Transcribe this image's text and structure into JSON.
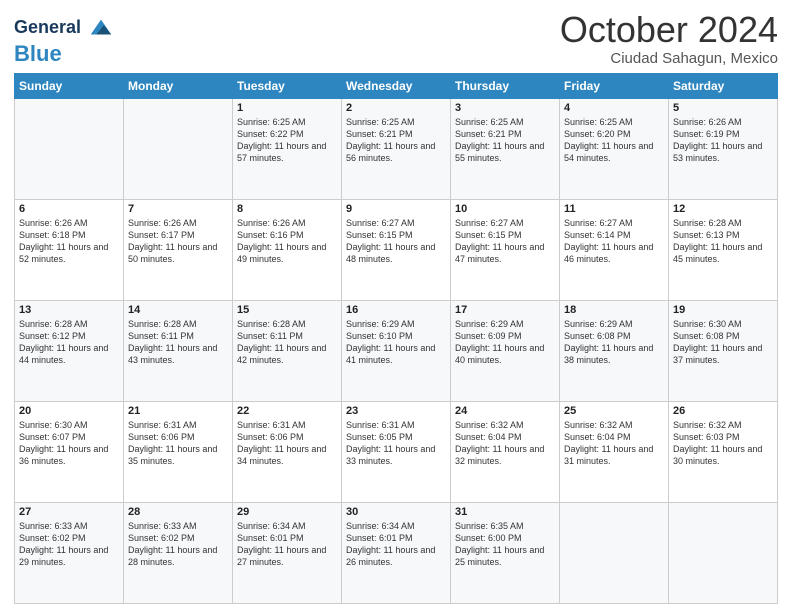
{
  "header": {
    "logo_line1": "General",
    "logo_line2": "Blue",
    "month": "October 2024",
    "location": "Ciudad Sahagun, Mexico"
  },
  "weekdays": [
    "Sunday",
    "Monday",
    "Tuesday",
    "Wednesday",
    "Thursday",
    "Friday",
    "Saturday"
  ],
  "weeks": [
    [
      {
        "day": "",
        "sunrise": "",
        "sunset": "",
        "daylight": ""
      },
      {
        "day": "",
        "sunrise": "",
        "sunset": "",
        "daylight": ""
      },
      {
        "day": "1",
        "sunrise": "Sunrise: 6:25 AM",
        "sunset": "Sunset: 6:22 PM",
        "daylight": "Daylight: 11 hours and 57 minutes."
      },
      {
        "day": "2",
        "sunrise": "Sunrise: 6:25 AM",
        "sunset": "Sunset: 6:21 PM",
        "daylight": "Daylight: 11 hours and 56 minutes."
      },
      {
        "day": "3",
        "sunrise": "Sunrise: 6:25 AM",
        "sunset": "Sunset: 6:21 PM",
        "daylight": "Daylight: 11 hours and 55 minutes."
      },
      {
        "day": "4",
        "sunrise": "Sunrise: 6:25 AM",
        "sunset": "Sunset: 6:20 PM",
        "daylight": "Daylight: 11 hours and 54 minutes."
      },
      {
        "day": "5",
        "sunrise": "Sunrise: 6:26 AM",
        "sunset": "Sunset: 6:19 PM",
        "daylight": "Daylight: 11 hours and 53 minutes."
      }
    ],
    [
      {
        "day": "6",
        "sunrise": "Sunrise: 6:26 AM",
        "sunset": "Sunset: 6:18 PM",
        "daylight": "Daylight: 11 hours and 52 minutes."
      },
      {
        "day": "7",
        "sunrise": "Sunrise: 6:26 AM",
        "sunset": "Sunset: 6:17 PM",
        "daylight": "Daylight: 11 hours and 50 minutes."
      },
      {
        "day": "8",
        "sunrise": "Sunrise: 6:26 AM",
        "sunset": "Sunset: 6:16 PM",
        "daylight": "Daylight: 11 hours and 49 minutes."
      },
      {
        "day": "9",
        "sunrise": "Sunrise: 6:27 AM",
        "sunset": "Sunset: 6:15 PM",
        "daylight": "Daylight: 11 hours and 48 minutes."
      },
      {
        "day": "10",
        "sunrise": "Sunrise: 6:27 AM",
        "sunset": "Sunset: 6:15 PM",
        "daylight": "Daylight: 11 hours and 47 minutes."
      },
      {
        "day": "11",
        "sunrise": "Sunrise: 6:27 AM",
        "sunset": "Sunset: 6:14 PM",
        "daylight": "Daylight: 11 hours and 46 minutes."
      },
      {
        "day": "12",
        "sunrise": "Sunrise: 6:28 AM",
        "sunset": "Sunset: 6:13 PM",
        "daylight": "Daylight: 11 hours and 45 minutes."
      }
    ],
    [
      {
        "day": "13",
        "sunrise": "Sunrise: 6:28 AM",
        "sunset": "Sunset: 6:12 PM",
        "daylight": "Daylight: 11 hours and 44 minutes."
      },
      {
        "day": "14",
        "sunrise": "Sunrise: 6:28 AM",
        "sunset": "Sunset: 6:11 PM",
        "daylight": "Daylight: 11 hours and 43 minutes."
      },
      {
        "day": "15",
        "sunrise": "Sunrise: 6:28 AM",
        "sunset": "Sunset: 6:11 PM",
        "daylight": "Daylight: 11 hours and 42 minutes."
      },
      {
        "day": "16",
        "sunrise": "Sunrise: 6:29 AM",
        "sunset": "Sunset: 6:10 PM",
        "daylight": "Daylight: 11 hours and 41 minutes."
      },
      {
        "day": "17",
        "sunrise": "Sunrise: 6:29 AM",
        "sunset": "Sunset: 6:09 PM",
        "daylight": "Daylight: 11 hours and 40 minutes."
      },
      {
        "day": "18",
        "sunrise": "Sunrise: 6:29 AM",
        "sunset": "Sunset: 6:08 PM",
        "daylight": "Daylight: 11 hours and 38 minutes."
      },
      {
        "day": "19",
        "sunrise": "Sunrise: 6:30 AM",
        "sunset": "Sunset: 6:08 PM",
        "daylight": "Daylight: 11 hours and 37 minutes."
      }
    ],
    [
      {
        "day": "20",
        "sunrise": "Sunrise: 6:30 AM",
        "sunset": "Sunset: 6:07 PM",
        "daylight": "Daylight: 11 hours and 36 minutes."
      },
      {
        "day": "21",
        "sunrise": "Sunrise: 6:31 AM",
        "sunset": "Sunset: 6:06 PM",
        "daylight": "Daylight: 11 hours and 35 minutes."
      },
      {
        "day": "22",
        "sunrise": "Sunrise: 6:31 AM",
        "sunset": "Sunset: 6:06 PM",
        "daylight": "Daylight: 11 hours and 34 minutes."
      },
      {
        "day": "23",
        "sunrise": "Sunrise: 6:31 AM",
        "sunset": "Sunset: 6:05 PM",
        "daylight": "Daylight: 11 hours and 33 minutes."
      },
      {
        "day": "24",
        "sunrise": "Sunrise: 6:32 AM",
        "sunset": "Sunset: 6:04 PM",
        "daylight": "Daylight: 11 hours and 32 minutes."
      },
      {
        "day": "25",
        "sunrise": "Sunrise: 6:32 AM",
        "sunset": "Sunset: 6:04 PM",
        "daylight": "Daylight: 11 hours and 31 minutes."
      },
      {
        "day": "26",
        "sunrise": "Sunrise: 6:32 AM",
        "sunset": "Sunset: 6:03 PM",
        "daylight": "Daylight: 11 hours and 30 minutes."
      }
    ],
    [
      {
        "day": "27",
        "sunrise": "Sunrise: 6:33 AM",
        "sunset": "Sunset: 6:02 PM",
        "daylight": "Daylight: 11 hours and 29 minutes."
      },
      {
        "day": "28",
        "sunrise": "Sunrise: 6:33 AM",
        "sunset": "Sunset: 6:02 PM",
        "daylight": "Daylight: 11 hours and 28 minutes."
      },
      {
        "day": "29",
        "sunrise": "Sunrise: 6:34 AM",
        "sunset": "Sunset: 6:01 PM",
        "daylight": "Daylight: 11 hours and 27 minutes."
      },
      {
        "day": "30",
        "sunrise": "Sunrise: 6:34 AM",
        "sunset": "Sunset: 6:01 PM",
        "daylight": "Daylight: 11 hours and 26 minutes."
      },
      {
        "day": "31",
        "sunrise": "Sunrise: 6:35 AM",
        "sunset": "Sunset: 6:00 PM",
        "daylight": "Daylight: 11 hours and 25 minutes."
      },
      {
        "day": "",
        "sunrise": "",
        "sunset": "",
        "daylight": ""
      },
      {
        "day": "",
        "sunrise": "",
        "sunset": "",
        "daylight": ""
      }
    ]
  ]
}
